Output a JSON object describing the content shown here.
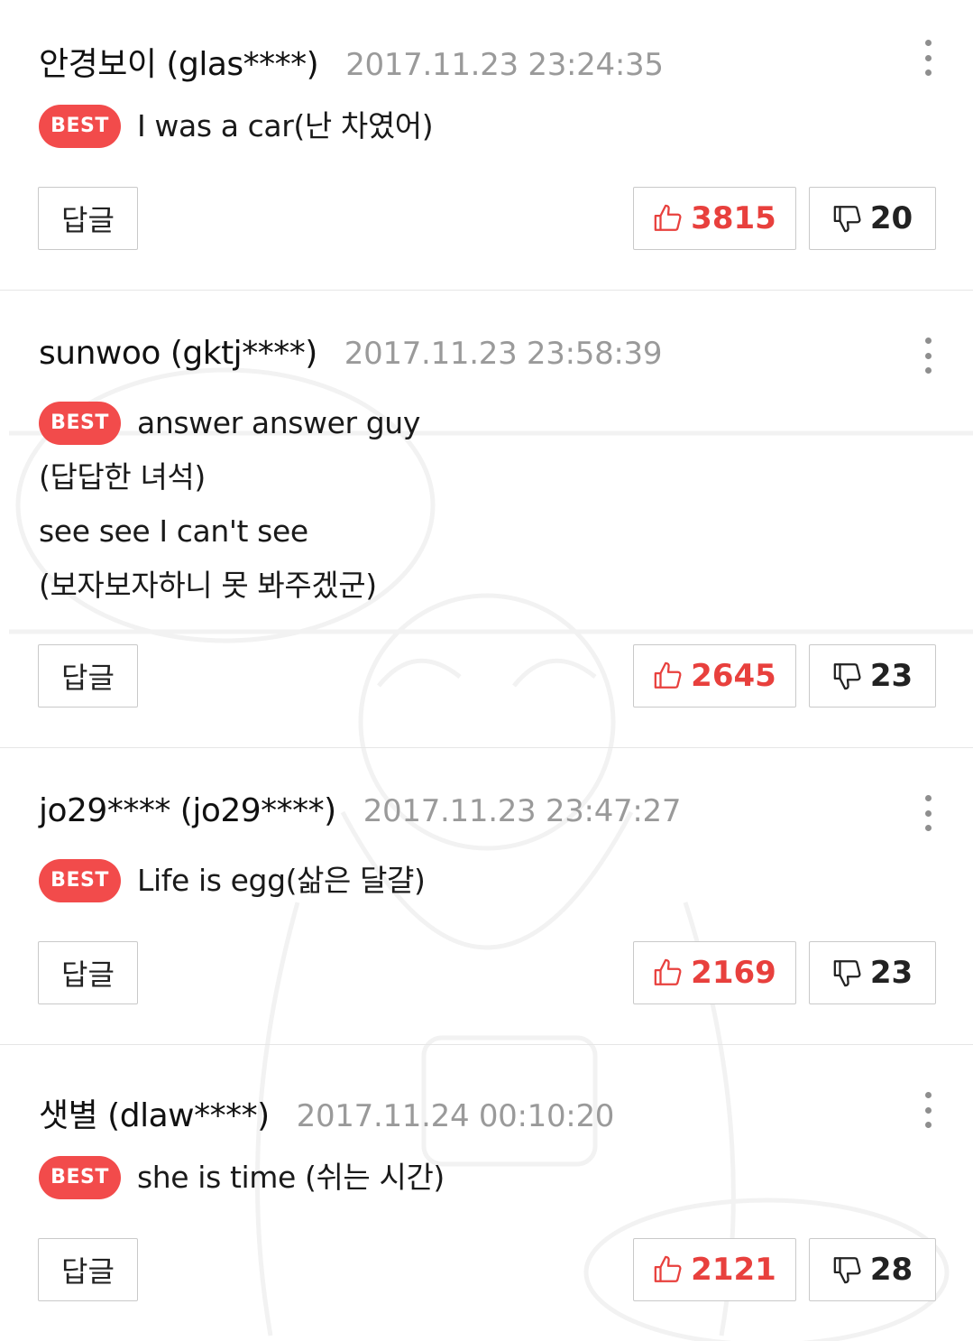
{
  "reply_label": "답글",
  "best_label": "BEST",
  "colors": {
    "like": "#e8403d",
    "best_badge": "#f24b4b",
    "date": "#9a9a9a"
  },
  "icons": {
    "like": "thumbs-up-icon",
    "dislike": "thumbs-down-icon",
    "more": "more-vertical-icon"
  },
  "comments": [
    {
      "author": "안경보이 (glas****)",
      "date": "2017.11.23 23:24:35",
      "lines": [
        "I was a car(난 차였어)"
      ],
      "likes": "3815",
      "dislikes": "20"
    },
    {
      "author": "sunwoo (gktj****)",
      "date": "2017.11.23 23:58:39",
      "lines": [
        "answer answer guy",
        "(답답한 녀석)",
        "see see I can't see",
        "(보자보자하니 못 봐주겠군)"
      ],
      "likes": "2645",
      "dislikes": "23"
    },
    {
      "author": "jo29**** (jo29****)",
      "date": "2017.11.23 23:47:27",
      "lines": [
        "Life is egg(삶은 달걀)"
      ],
      "likes": "2169",
      "dislikes": "23"
    },
    {
      "author": "샛별 (dlaw****)",
      "date": "2017.11.24 00:10:20",
      "lines": [
        "she is time (쉬는 시간)"
      ],
      "likes": "2121",
      "dislikes": "28"
    }
  ]
}
